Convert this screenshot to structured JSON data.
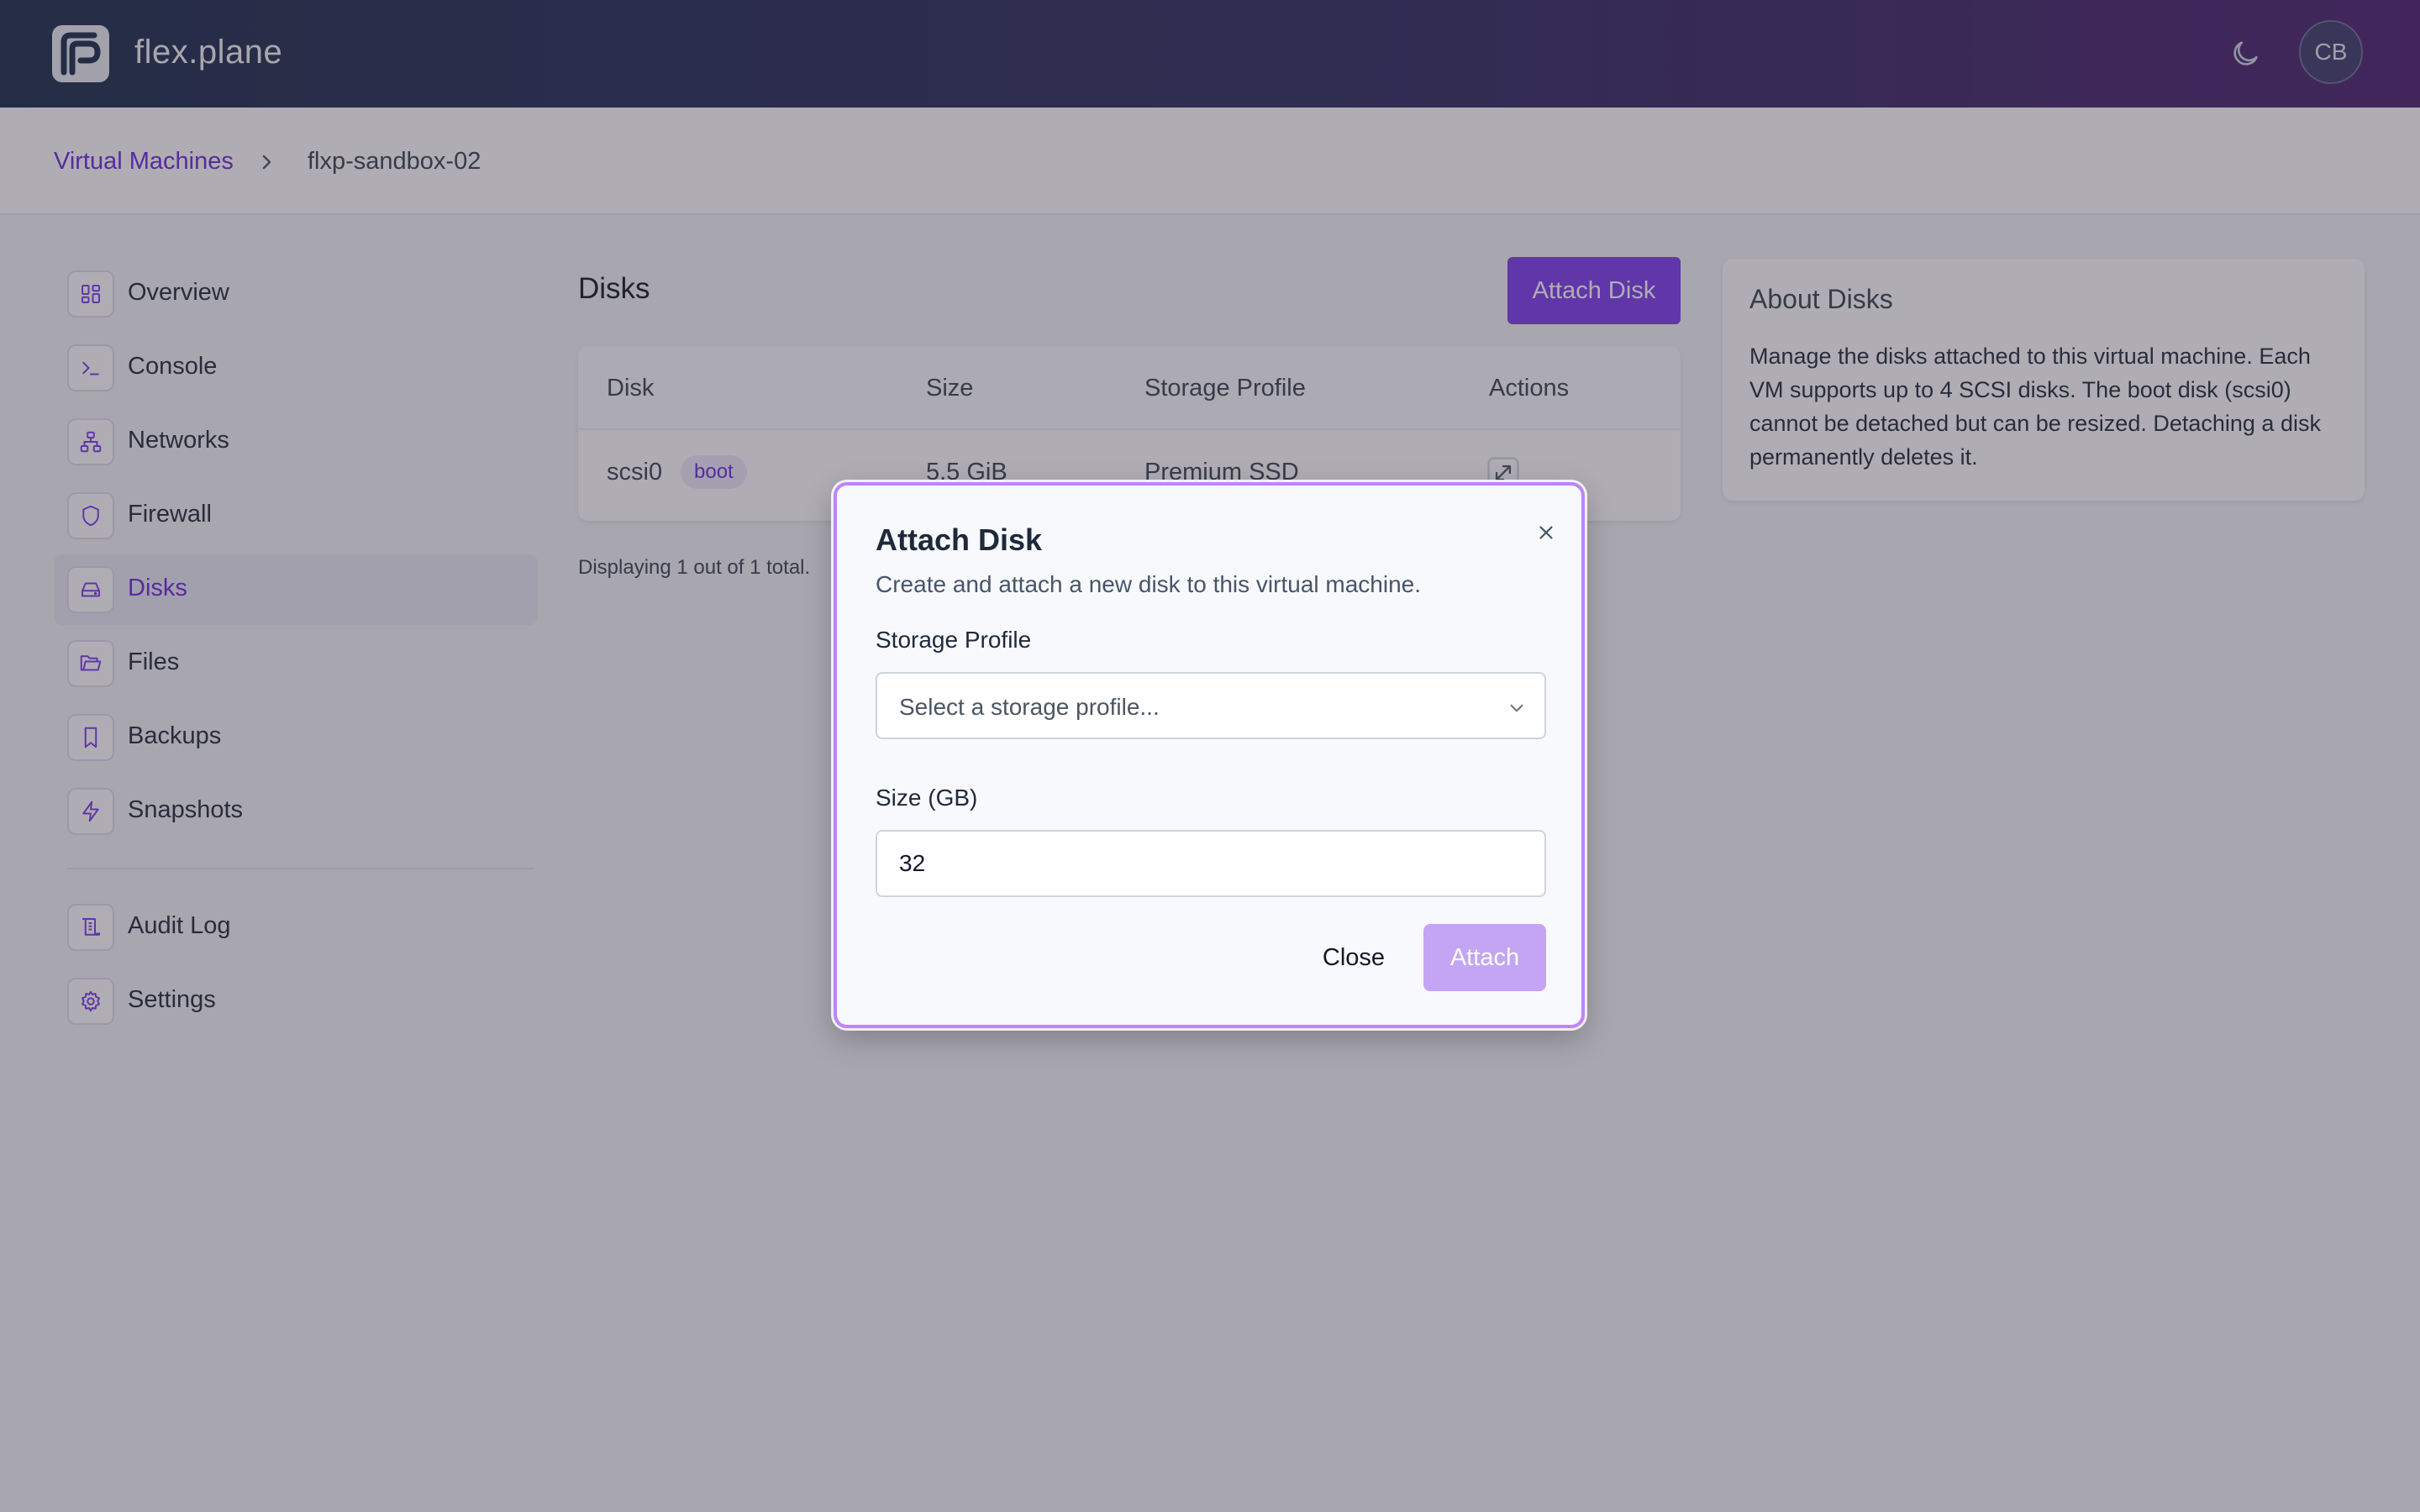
{
  "app": {
    "brand": "flex.plane",
    "avatar_initials": "CB"
  },
  "breadcrumb": {
    "parent": "Virtual Machines",
    "current": "flxp-sandbox-02"
  },
  "sidebar": {
    "items": [
      {
        "label": "Overview",
        "icon": "overview-icon"
      },
      {
        "label": "Console",
        "icon": "console-icon"
      },
      {
        "label": "Networks",
        "icon": "network-icon"
      },
      {
        "label": "Firewall",
        "icon": "shield-icon"
      },
      {
        "label": "Disks",
        "icon": "disk-icon",
        "active": true
      },
      {
        "label": "Files",
        "icon": "folder-icon"
      },
      {
        "label": "Backups",
        "icon": "bookmark-icon"
      },
      {
        "label": "Snapshots",
        "icon": "lightning-icon"
      }
    ],
    "secondary": [
      {
        "label": "Audit Log",
        "icon": "audit-log-icon"
      },
      {
        "label": "Settings",
        "icon": "gear-icon"
      }
    ]
  },
  "main": {
    "title": "Disks",
    "attach_button": "Attach Disk",
    "table": {
      "columns": [
        "Disk",
        "Size",
        "Storage Profile",
        "Actions"
      ],
      "rows": [
        {
          "disk": "scsi0",
          "badge": "boot",
          "size": "5.5 GiB",
          "profile": "Premium SSD",
          "action_icon": "resize-icon"
        }
      ]
    },
    "footer": "Displaying 1 out of 1 total."
  },
  "about": {
    "title": "About Disks",
    "body": "Manage the disks attached to this virtual machine. Each VM supports up to 4 SCSI disks. The boot disk (scsi0) cannot be detached but can be resized. Detaching a disk permanently deletes it."
  },
  "modal": {
    "title": "Attach Disk",
    "subtitle": "Create and attach a new disk to this virtual machine.",
    "storage_label": "Storage Profile",
    "storage_placeholder": "Select a storage profile...",
    "size_label": "Size (GB)",
    "size_value": "32",
    "close_label": "Close",
    "attach_label": "Attach"
  },
  "colors": {
    "accent": "#7c3aed",
    "modal_border": "#c084fc",
    "attach_disabled": "#c4a5f3"
  }
}
